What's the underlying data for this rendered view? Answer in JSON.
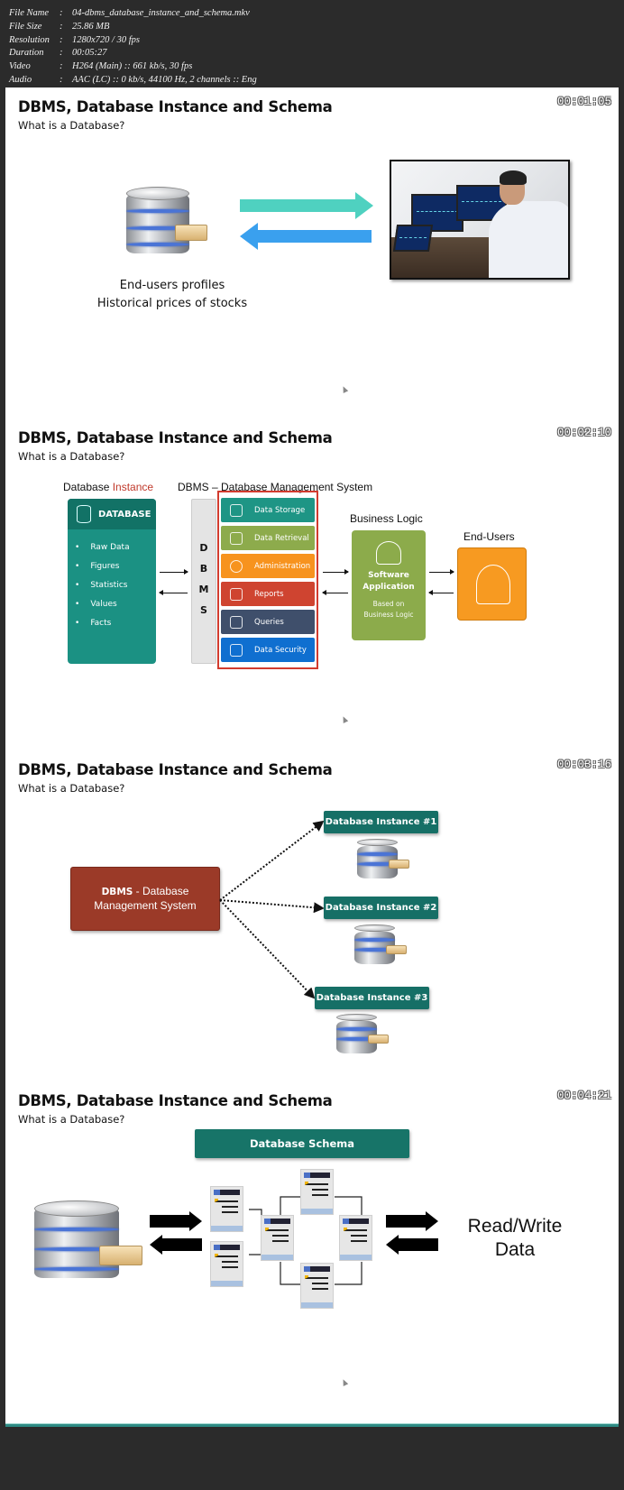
{
  "file_info": [
    {
      "key": "File Name",
      "value": "04-dbms_database_instance_and_schema.mkv"
    },
    {
      "key": "File Size",
      "value": "25.86 MB"
    },
    {
      "key": "Resolution",
      "value": "1280x720 / 30 fps"
    },
    {
      "key": "Duration",
      "value": "00:05:27"
    },
    {
      "key": "Video",
      "value": "H264 (Main) :: 661 kb/s, 30 fps"
    },
    {
      "key": "Audio",
      "value": "AAC (LC) :: 0 kb/s, 44100 Hz, 2 channels :: Eng"
    }
  ],
  "separator": ":",
  "slides": [
    {
      "title": "DBMS, Database Instance and Schema",
      "subtitle": "What is a Database?",
      "timestamp": "00:01:05",
      "caption_lines": [
        "End-users profiles",
        "Historical prices of stocks"
      ],
      "arrow_colors": {
        "right": "#4fd1c0",
        "left": "#3aa0ee"
      },
      "image": "trader-at-monitors-photo"
    },
    {
      "title": "DBMS, Database Instance and Schema",
      "subtitle": "What is a Database?",
      "timestamp": "00:02:10",
      "instance_label_prefix": "Database ",
      "instance_label_highlight": "Instance",
      "dbms_label": "DBMS – Database Management System",
      "database_box": {
        "heading": "DATABASE",
        "items": [
          "Raw Data",
          "Figures",
          "Statistics",
          "Values",
          "Facts"
        ]
      },
      "dbms_letters": [
        "D",
        "B",
        "M",
        "S"
      ],
      "functions": [
        {
          "label": "Data Storage",
          "color": "#1e9585",
          "icon": "cloud-icon"
        },
        {
          "label": "Data Retrieval",
          "color": "#8dab4c",
          "icon": "server-search-icon"
        },
        {
          "label": "Administration",
          "color": "#f7931e",
          "icon": "gear-icon"
        },
        {
          "label": "Reports",
          "color": "#cf4430",
          "icon": "report-chart-icon"
        },
        {
          "label": "Queries",
          "color": "#3f4f6b",
          "icon": "query-network-icon"
        },
        {
          "label": "Data Security",
          "color": "#0f6fd0",
          "icon": "lock-icon"
        }
      ],
      "business_logic_label": "Business Logic",
      "app_box": {
        "title_lines": [
          "Software",
          "Application"
        ],
        "sub_lines": [
          "Based on",
          "Business Logic"
        ]
      },
      "end_users_label": "End-Users"
    },
    {
      "title": "DBMS, Database Instance and Schema",
      "subtitle": "What is a Database?",
      "timestamp": "00:03:16",
      "dbms_box_bold": "DBMS",
      "dbms_box_rest": " - Database",
      "dbms_box_line2": "Management System",
      "instances": [
        "Database Instance #1",
        "Database Instance #2",
        "Database Instance #3"
      ]
    },
    {
      "title": "DBMS, Database Instance and Schema",
      "subtitle": "What is a Database?",
      "timestamp": "00:04:21",
      "schema_label": "Database Schema",
      "rw_lines": [
        "Read/Write",
        "Data"
      ]
    }
  ]
}
